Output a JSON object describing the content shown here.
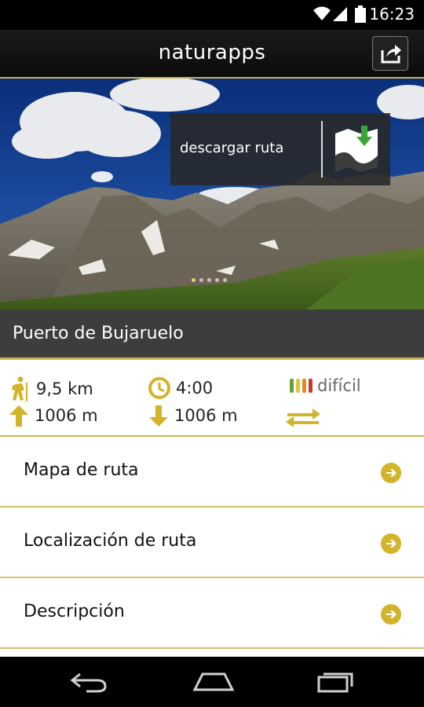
{
  "status_bar": {
    "time": "16:23"
  },
  "app": {
    "title": "naturapps"
  },
  "hero": {
    "download_label": "descargar ruta",
    "slides_count": 5,
    "active_slide": 1
  },
  "route": {
    "name": "Puerto de Bujaruelo",
    "distance": "9,5 km",
    "duration": "4:00",
    "difficulty": "difícil",
    "ascent": "1006 m",
    "descent": "1006 m"
  },
  "menu": [
    {
      "label": "Mapa de ruta"
    },
    {
      "label": "Localización de ruta"
    },
    {
      "label": "Descripción"
    }
  ],
  "colors": {
    "accent": "#d2b32a",
    "accent_line": "#c9b350",
    "difficulty_bars": [
      "#6a9e3a",
      "#e0c43a",
      "#e0892a",
      "#c8382c"
    ]
  }
}
